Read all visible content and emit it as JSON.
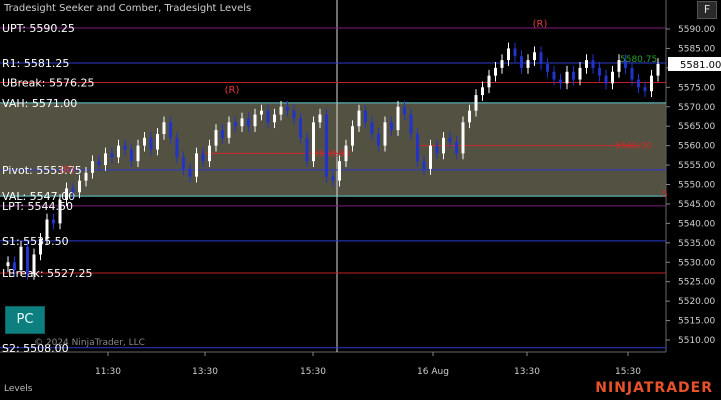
{
  "header": {
    "title": "Tradesight Seeker and Comber, Tradesight Levels"
  },
  "corner_button": "F",
  "pc_button": "PC",
  "footer": {
    "left": "Levels",
    "copyright": "© 2024 NinjaTrader, LLC",
    "brand": "NINJATRADER"
  },
  "colors": {
    "bg": "#000000",
    "candle_up": "#ffffff",
    "candle_down": "#2233cc",
    "value_area": "#5c5a48",
    "accent_red": "#cc2a2a",
    "accent_green": "#2aa02a"
  },
  "chart_data": {
    "type": "line",
    "ylim": [
      5507,
      5594
    ],
    "y_ticks": [
      5510,
      5515,
      5520,
      5525,
      5530,
      5535,
      5540,
      5545,
      5550,
      5555,
      5560,
      5565,
      5570,
      5575,
      5580,
      5585,
      5590
    ],
    "last_price": "5581.00",
    "x_tick_labels": [
      "11:30",
      "13:30",
      "15:30",
      "16 Aug",
      "13:30",
      "15:30"
    ],
    "levels": [
      {
        "label": "UPT: 5590.25",
        "price": 5590.25,
        "color": "#7a1f7a"
      },
      {
        "label": "R1: 5581.25",
        "price": 5581.25,
        "color": "#2b3bd0"
      },
      {
        "label": "UBreak: 5576.25",
        "price": 5576.25,
        "color": "#c02020"
      },
      {
        "label": "VAH: 5571.00",
        "price": 5571.0,
        "color": "#5fd0d0"
      },
      {
        "label": "Pivot: 5553.75",
        "price": 5553.75,
        "color": "#2b3bd0"
      },
      {
        "label": "VAL: 5547.00",
        "price": 5547.0,
        "color": "#5fd0d0"
      },
      {
        "label": "LPT: 5544.50",
        "price": 5544.5,
        "color": "#7a1f7a"
      },
      {
        "label": "S1: 5535.50",
        "price": 5535.5,
        "color": "#2b3bd0"
      },
      {
        "label": "LBreak: 5527.25",
        "price": 5527.25,
        "color": "#c02020"
      },
      {
        "label": "S2: 5508.00",
        "price": 5508.0,
        "color": "#2b3bd0"
      }
    ],
    "value_area": [
      5547.0,
      5571.0
    ],
    "red_segments": [
      {
        "text": "5558.00",
        "price": 5558.0
      },
      {
        "text": "5560.00",
        "price": 5560.0
      }
    ],
    "markers": [
      {
        "text": "(R)",
        "price": 5552.5
      },
      {
        "text": "(R)",
        "price": 5573.0
      },
      {
        "text": "(R)",
        "price": 5590.0
      }
    ],
    "annotations": [
      "5580.75",
      "5"
    ],
    "closes": [
      5530,
      5528,
      5534,
      5527,
      5532,
      5536,
      5541,
      5540,
      5546,
      5549,
      5548,
      5551,
      5553,
      5556,
      5555,
      5558,
      5557,
      5560,
      5559,
      5556,
      5560,
      5562,
      5559,
      5563,
      5566,
      5562,
      5557,
      5554,
      5552,
      5558,
      5556,
      5560,
      5564,
      5562,
      5566,
      5565,
      5567,
      5565,
      5568,
      5569,
      5566,
      5568,
      5570,
      5569,
      5567,
      5562,
      5556,
      5566,
      5568,
      5552,
      5551,
      5556,
      5560,
      5565,
      5569,
      5566,
      5563,
      5560,
      5566,
      5564,
      5570,
      5568,
      5563,
      5556,
      5554,
      5560,
      5558,
      5562,
      5561,
      5558,
      5566,
      5569,
      5573,
      5575,
      5578,
      5580,
      5582,
      5585,
      5583,
      5580,
      5582,
      5584,
      5581,
      5579,
      5577,
      5576,
      5579,
      5577,
      5580,
      5582,
      5580,
      5578,
      5576,
      5579,
      5582,
      5580,
      5577,
      5575,
      5574,
      5578,
      5581
    ]
  }
}
